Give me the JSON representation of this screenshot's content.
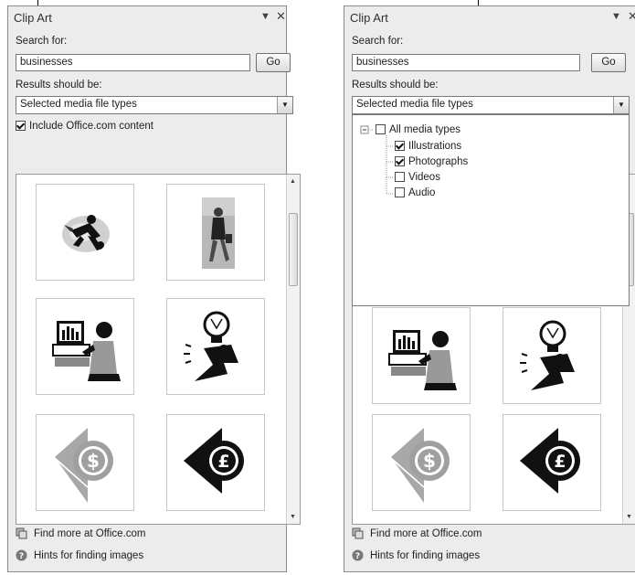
{
  "left": {
    "title": "Clip Art",
    "search_label": "Search for:",
    "search_value": "businesses",
    "go_label": "Go",
    "results_label": "Results should be:",
    "media_select": "Selected media file types",
    "include_label": "Include Office.com content",
    "include_checked": true,
    "footer": {
      "find_more": "Find more at Office.com",
      "hints": "Hints for finding images"
    }
  },
  "right": {
    "title": "Clip Art",
    "search_label": "Search for:",
    "search_value": "businesses",
    "go_label": "Go",
    "results_label": "Results should be:",
    "media_select": "Selected media file types",
    "media_types": {
      "root": {
        "label": "All media types",
        "checked": false
      },
      "items": [
        {
          "label": "Illustrations",
          "checked": true
        },
        {
          "label": "Photographs",
          "checked": true
        },
        {
          "label": "Videos",
          "checked": false
        },
        {
          "label": "Audio",
          "checked": false
        }
      ]
    },
    "footer": {
      "find_more": "Find more at Office.com",
      "hints": "Hints for finding images"
    }
  },
  "icons": {
    "pane_menu": "pane-menu-arrow-icon",
    "close": "close-icon",
    "find_more": "office-globe-icon",
    "hints": "help-icon"
  },
  "colors": {
    "pane_bg": "#ececec",
    "tree_line": "#9a9a9a"
  }
}
